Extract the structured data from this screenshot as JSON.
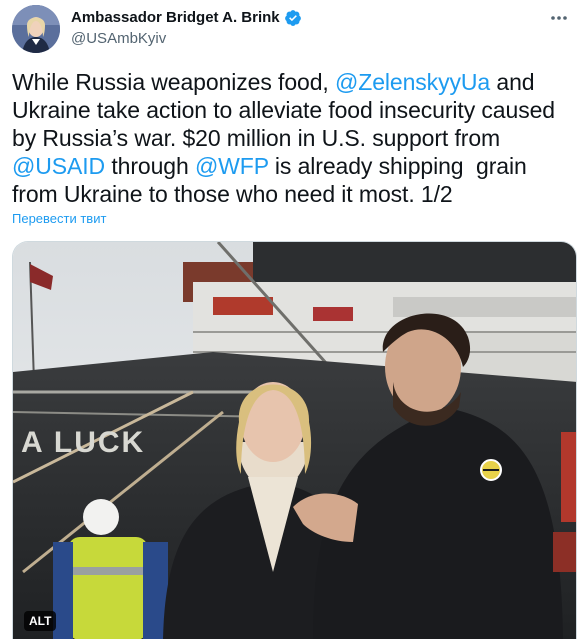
{
  "author": {
    "display_name": "Ambassador Bridget A. Brink",
    "handle": "@USAmbKyiv",
    "verified": true
  },
  "tweet": {
    "segments": [
      {
        "text": "While Russia weaponizes food, ",
        "type": "text"
      },
      {
        "text": "@ZelenskyyUa",
        "type": "mention"
      },
      {
        "text": " and Ukraine take action to alleviate food insecurity caused by Russia’s war. $20 million in U.S. support from ",
        "type": "text"
      },
      {
        "text": "@USAID",
        "type": "mention"
      },
      {
        "text": " through ",
        "type": "text"
      },
      {
        "text": "@WFP",
        "type": "mention"
      },
      {
        "text": " is already shipping  grain from Ukraine to those who need it most. 1/2",
        "type": "text"
      }
    ],
    "translate_label": "Перевести твит"
  },
  "media": {
    "alt_badge": "ALT",
    "ship_lettering": "A LUCK"
  },
  "colors": {
    "accent": "#1d9bf0",
    "text": "#0f1419",
    "secondary": "#536471"
  },
  "icons": {
    "verified": "verified-badge-icon",
    "more": "more-options-icon"
  }
}
